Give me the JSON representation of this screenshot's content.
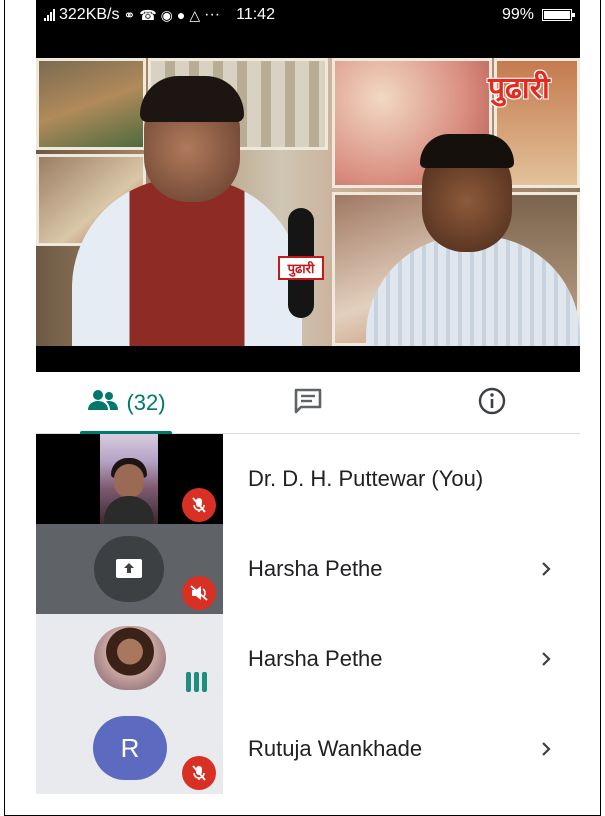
{
  "status_bar": {
    "speed": "322KB/s",
    "time": "11:42",
    "battery": "99%",
    "more": "···"
  },
  "video": {
    "brand_logo_text": "पुढारी",
    "mic_logo_text": "पुढारी"
  },
  "tabs": {
    "people_count": "(32)",
    "active": "people"
  },
  "participants": [
    {
      "name": "Dr. D. H. Puttewar (You)",
      "tile": "camera",
      "muted": true,
      "has_chevron": false
    },
    {
      "name": "Harsha Pethe",
      "tile": "presenting",
      "muted": true,
      "has_chevron": true
    },
    {
      "name": "Harsha Pethe",
      "tile": "photo",
      "muted": false,
      "speaking": true,
      "has_chevron": true
    },
    {
      "name": "Rutuja Wankhade",
      "tile": "letter",
      "avatar_letter": "R",
      "avatar_color": "#5c6bc0",
      "muted": true,
      "has_chevron": true
    }
  ],
  "colors": {
    "accent": "#00796b",
    "muted_badge": "#d93025",
    "tile_dark": "#000000",
    "tile_grey": "#5f6368",
    "tile_light": "#e8eaed",
    "speaking": "#1e8e7e"
  },
  "icons": {
    "people_tab": "people-icon",
    "chat_tab": "chat-icon",
    "info_tab": "info-icon",
    "muted": "mic-off-icon",
    "presenting": "present-screen-icon",
    "speaking": "audio-level-icon",
    "chevron": "chevron-right-icon"
  }
}
